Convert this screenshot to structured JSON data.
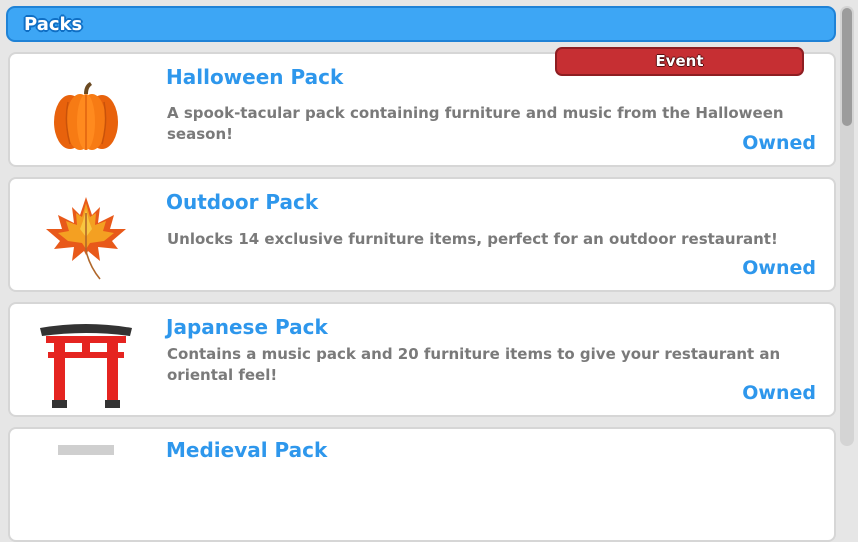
{
  "header": {
    "title": "Packs"
  },
  "packs": [
    {
      "title": "Halloween Pack",
      "description": "A spook-tacular pack containing furniture and music from the Halloween season!",
      "status": "Owned",
      "badge": "Event",
      "icon": "pumpkin-icon"
    },
    {
      "title": "Outdoor Pack",
      "description": "Unlocks 14 exclusive furniture items, perfect for an outdoor restaurant!",
      "status": "Owned",
      "icon": "maple-leaf-icon"
    },
    {
      "title": "Japanese Pack",
      "description": "Contains a music pack and 20 furniture items to give your restaurant an oriental feel!",
      "status": "Owned",
      "icon": "torii-gate-icon"
    },
    {
      "title": "Medieval Pack",
      "icon": "medieval-icon"
    }
  ],
  "colors": {
    "header": "#3da6f5",
    "title": "#2e97ec",
    "event_badge": "#c62f33",
    "description": "#7a7a7a"
  }
}
